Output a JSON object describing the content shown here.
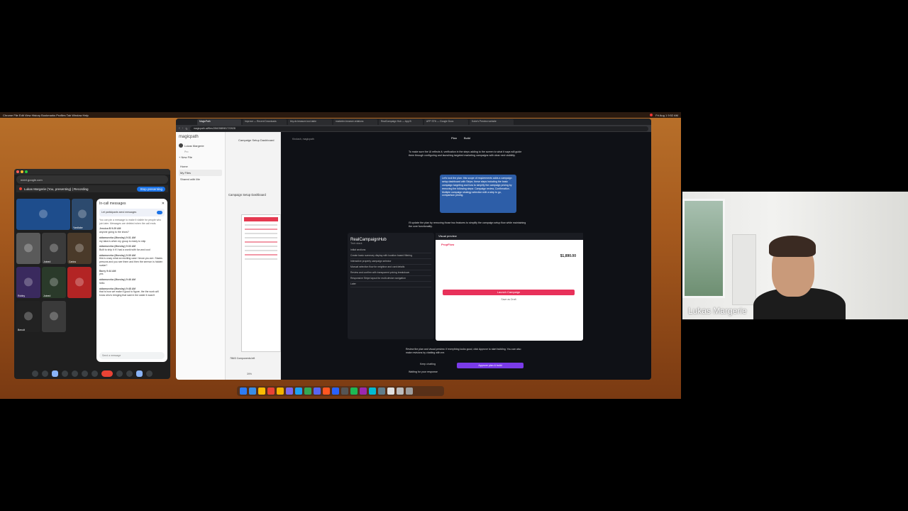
{
  "menubar": {
    "left": "Chrome  File  Edit  View  History  Bookmarks  Profiles  Tab  Window  Help",
    "right": "Fri Aug 1 9:52 AM"
  },
  "meet": {
    "address": "meet.google.com",
    "presenting_text": "Lukas Margerie (You, presenting) | Recording",
    "stop_label": "Stop presenting",
    "tiles": [
      {
        "name": "",
        "color": "#1e4d8c"
      },
      {
        "name": "Yardlake",
        "color": "#2c4a6e"
      },
      {
        "name": "",
        "color": "#5a5a5a"
      },
      {
        "name": "Joined",
        "color": "#3b3b3b"
      },
      {
        "name": "Carlos",
        "color": "#4a3a2a"
      },
      {
        "name": "Robby",
        "color": "#3a2a5e"
      },
      {
        "name": "Joined",
        "color": "#2a3a2a"
      },
      {
        "name": "",
        "color": "#b32424"
      },
      {
        "name": "Benoit",
        "color": "#222"
      },
      {
        "name": "",
        "color": "#3a3a3a"
      }
    ],
    "chat": {
      "title": "In-call messages",
      "toggle_label": "Let participants send messages",
      "info": "You can pin a message to make it visible for people who join later. Messages are deleted when the call ends.",
      "messages": [
        {
          "who": "Jessica B  9:29 AM",
          "text": "anyone going to the show?"
        },
        {
          "who": "aidamuneka (Monday)  9:31 AM",
          "text": "my taba is when my group is ready to ship"
        },
        {
          "who": "aidamuneka (Monday)  9:33 AM",
          "text": "Built to ship it if I had a world with fun and cool"
        },
        {
          "who": "aidamuneka (Monday)  9:39 AM",
          "text": "this is crazy what an exciting case I know you are. Stacks persons and you see them and then the sermon is hidden scalar?"
        },
        {
          "who": "Barry  9:44 AM",
          "text": "yes"
        },
        {
          "who": "aidamuneka (Monday)  9:46 AM",
          "text": "hello"
        },
        {
          "who": "aidamuneka (Monday)  9:48 AM",
          "text": "that is how we make it good to figure, the the work will know who's bringing that said in the water it wasn't"
        }
      ],
      "send_placeholder": "Send a message"
    }
  },
  "browser": {
    "tabs": [
      "MagicPath",
      "Improve — Recent Downloads",
      "tiny.dx.treasure-tool-table",
      "marketer-browser-relations",
      "RealCampaign Hub — App B",
      "APP STN — Google Docs",
      "Kobe's Preview website"
    ],
    "url": "magicpath.ai/files/2840388981723928"
  },
  "app": {
    "brand": "magicpath",
    "user": "Lukas Margerie",
    "user_plan": "Pro",
    "new_file": "New File",
    "nav": [
      "Home",
      "My Files",
      "Shared with Me"
    ],
    "canvas_header": "Campaign Setup Dashboard",
    "frame_title": "Campaign Setup Dashboard",
    "components_left": "786/3 Components left",
    "zoom": "39%"
  },
  "dark": {
    "path": "Kirolash, magicpath",
    "mode_plan": "Plan",
    "mode_build": "Build",
    "intro": "To make sure the UI reflects it, verification in the steps adding to the screen to what it says will guide them through configuring and launching targeted marketing campaigns with clear next visibility.",
    "bubble": "Let's lock the plan: this scope of requirements adds a campaign setup dashboard with Stripe, these steps including the basic campaign targeting and how to simplify the campaign pricing by removing the following steps: Campaign review, Confirmation. Multiple campaign strategy selection with a step to go, comparison pricing.",
    "after_bubble": "I'll update the plan by removing those two features to simplify the campaign setup flow while maintaining the core functionality.",
    "panel_title": "RealCampaignHub",
    "panel_sub": "Tech stack",
    "panel_sections": [
      "Initial sections",
      "Create basic summary display with location based filtering",
      "Interactive property campaign selector",
      "Manual selection flow for neighbor and card details",
      "Review and confirm with transparent pricing breakdown",
      "Responsive Stripe layout for multi-device navigation",
      "Later"
    ],
    "preview_title": "Visual preview",
    "preview_brand": "PropFlow",
    "preview_price": "$1,890.00",
    "launch_label": "Launch Campaign",
    "save_label": "Save as Draft",
    "feedback": "Review the plan and visual preview. If everything looks good, click Approve to start building. You can also make revisions by chatting with me.",
    "keep_label": "Keep chatting",
    "approve_label": "Approve plan & build",
    "waiting": "Waiting for your response"
  },
  "dock_colors": [
    "#2d7cf6",
    "#3a8ee6",
    "#fbbc04",
    "#e94235",
    "#f4b400",
    "#7b68ee",
    "#1da1f2",
    "#34a853",
    "#5865f2",
    "#ff5722",
    "#2962ff",
    "#555",
    "#1db954",
    "#9c27b0",
    "#00bcd4",
    "#607d8b",
    "#e0e0e0",
    "#bdbdbd",
    "#9e9e9e"
  ],
  "webcam": {
    "name": "Lukas Margerie"
  }
}
